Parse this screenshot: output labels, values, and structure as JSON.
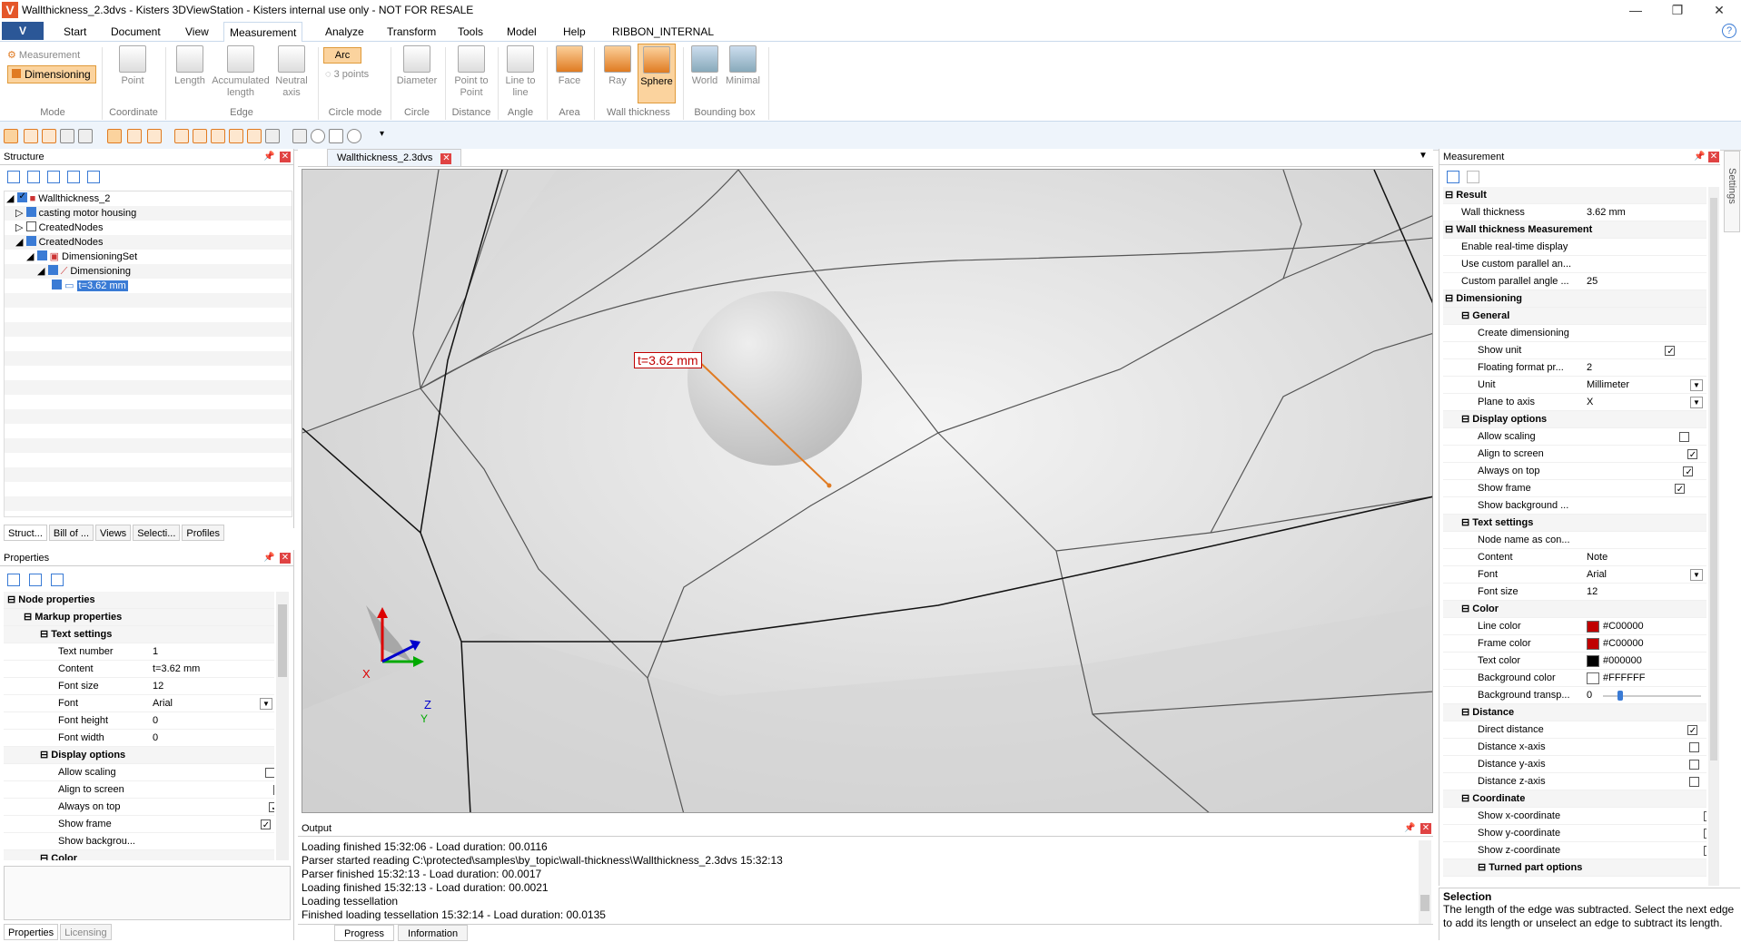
{
  "window": {
    "title": "Wallthickness_2.3dvs - Kisters 3DViewStation - Kisters internal use only - NOT FOR RESALE",
    "logo": "V",
    "minimize": "—",
    "restore": "❐",
    "close": "✕"
  },
  "menu": {
    "app_button": "V",
    "items": [
      "Start",
      "Document",
      "View",
      "Measurement",
      "Analyze",
      "Transform",
      "Tools",
      "Model",
      "Help",
      "RIBBON_INTERNAL"
    ],
    "active": "Measurement",
    "help_icon": "?"
  },
  "ribbon": {
    "mode": {
      "measurement": "Measurement",
      "dimensioning": "Dimensioning",
      "label": "Mode"
    },
    "coordinate": {
      "point": "Point",
      "label": "Coordinate"
    },
    "edge": {
      "length": "Length",
      "accumulated": "Accumulated length",
      "neutral": "Neutral axis",
      "label": "Edge"
    },
    "circle_mode": {
      "arc": "Arc",
      "three_points": "3 points",
      "label": "Circle mode"
    },
    "circle": {
      "diameter": "Diameter",
      "label": "Circle"
    },
    "distance": {
      "p2p": "Point to Point",
      "label": "Distance"
    },
    "angle": {
      "line": "Line to line",
      "label": "Angle"
    },
    "area": {
      "face": "Face",
      "label": "Area"
    },
    "wall": {
      "ray": "Ray",
      "sphere": "Sphere",
      "label": "Wall thickness"
    },
    "bbox": {
      "world": "World",
      "minimal": "Minimal",
      "label": "Bounding box"
    }
  },
  "structure": {
    "title": "Structure",
    "items": [
      {
        "label": "Wallthickness_2"
      },
      {
        "label": "casting motor housing"
      },
      {
        "label": "CreatedNodes"
      },
      {
        "label": "CreatedNodes"
      },
      {
        "label": "DimensioningSet"
      },
      {
        "label": "Dimensioning"
      },
      {
        "label": "t=3.62 mm"
      }
    ],
    "tabs": [
      "Struct...",
      "Bill of ...",
      "Views",
      "Selecti...",
      "Profiles"
    ]
  },
  "properties": {
    "title": "Properties",
    "node_properties": "Node properties",
    "markup_properties": "Markup properties",
    "text_settings": "Text settings",
    "display_options": "Display options",
    "color": "Color",
    "rows": [
      {
        "k": "Text number",
        "v": "1"
      },
      {
        "k": "Content",
        "v": "t=3.62 mm"
      },
      {
        "k": "Font size",
        "v": "12"
      },
      {
        "k": "Font",
        "v": "Arial"
      },
      {
        "k": "Font height",
        "v": "0"
      },
      {
        "k": "Font width",
        "v": "0"
      }
    ],
    "display": [
      {
        "k": "Allow scaling"
      },
      {
        "k": "Align to screen"
      },
      {
        "k": "Always on top"
      },
      {
        "k": "Show frame"
      },
      {
        "k": "Show backgrou..."
      }
    ],
    "tabs": [
      "Properties",
      "Licensing"
    ]
  },
  "viewport": {
    "tab": "Wallthickness_2.3dvs",
    "label": "t=3.62 mm",
    "axis_x": "X",
    "axis_y": "Y",
    "axis_z": "Z"
  },
  "output": {
    "title": "Output",
    "lines": [
      "Loading finished 15:32:06 - Load duration: 00.0116",
      "Parser started reading C:\\protected\\samples\\by_topic\\wall-thickness\\Wallthickness_2.3dvs 15:32:13",
      "Parser finished 15:32:13 - Load duration: 00.0017",
      "Loading finished 15:32:13 - Load duration: 00.0021",
      "Loading tessellation",
      "Finished loading tessellation 15:32:14 - Load duration: 00.0135"
    ],
    "tabs": [
      "Progress",
      "Information"
    ]
  },
  "measurement": {
    "title": "Measurement",
    "side_tab": "Settings",
    "result": "Result",
    "wall_thickness_k": "Wall thickness",
    "wall_thickness_v": "3.62 mm",
    "wtm": "Wall thickness Measurement",
    "rt": "Enable real-time display",
    "cp": "Use custom parallel an...",
    "ca_k": "Custom parallel angle ...",
    "ca_v": "25",
    "dimensioning": "Dimensioning",
    "general": "General",
    "cd": "Create dimensioning",
    "su": "Show unit",
    "ff_k": "Floating format pr...",
    "ff_v": "2",
    "unit_k": "Unit",
    "unit_v": "Millimeter",
    "plane_k": "Plane to axis",
    "plane_v": "X",
    "display_options": "Display options",
    "as": "Allow scaling",
    "ats": "Align to screen",
    "aot": "Always on top",
    "sf": "Show frame",
    "sb": "Show background ...",
    "text_settings": "Text settings",
    "nn": "Node name as con...",
    "content_k": "Content",
    "content_v": "Note",
    "font_k": "Font",
    "font_v": "Arial",
    "fs_k": "Font size",
    "fs_v": "12",
    "color": "Color",
    "lc_k": "Line color",
    "lc_v": "#C00000",
    "fc_k": "Frame color",
    "fc_v": "#C00000",
    "tc_k": "Text color",
    "tc_v": "#000000",
    "bc_k": "Background color",
    "bc_v": "#FFFFFF",
    "bt_k": "Background transp...",
    "bt_v": "0",
    "distance": "Distance",
    "dd": "Direct distance",
    "dx": "Distance x-axis",
    "dy": "Distance y-axis",
    "dz": "Distance z-axis",
    "coordinate": "Coordinate",
    "sx": "Show x-coordinate",
    "sy": "Show y-coordinate",
    "sz": "Show z-coordinate",
    "turned": "Turned part options"
  },
  "selection": {
    "title": "Selection",
    "text": "The length of the edge was subtracted. Select the next edge to add its length or unselect an edge to subtract its length."
  },
  "colors": {
    "accent": "#e07b22",
    "line": "#C00000"
  }
}
